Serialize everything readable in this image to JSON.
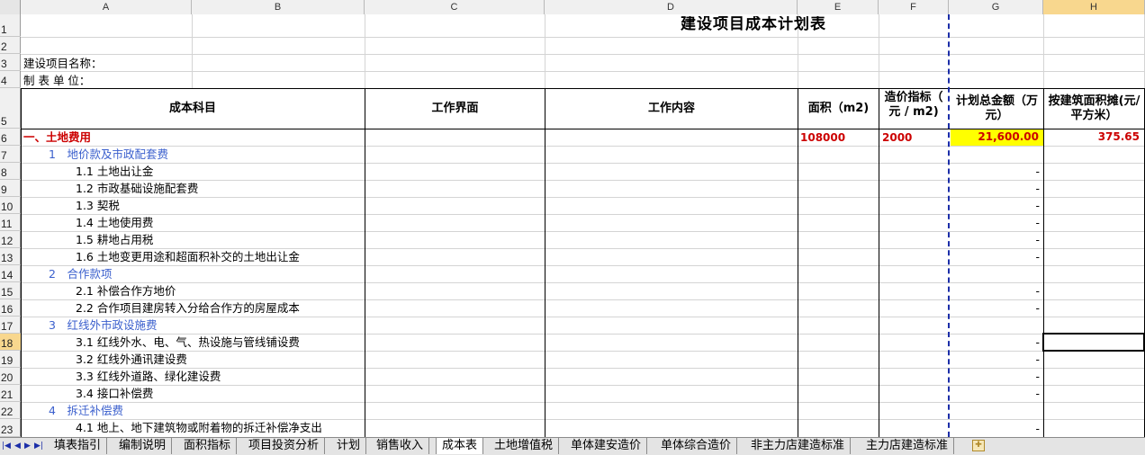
{
  "colors": {
    "header_bg": "#f0f0f0",
    "selected_header": "#f8d78e",
    "highlight_cell": "#ffff00",
    "section_red": "#cc0000",
    "subsection_blue": "#3a5fcd",
    "page_break": "#1c2ea8"
  },
  "columns": [
    "A",
    "B",
    "C",
    "D",
    "E",
    "F",
    "G",
    "H"
  ],
  "row_numbers": [
    "1",
    "2",
    "3",
    "4",
    "5",
    "6",
    "7",
    "8",
    "9",
    "10",
    "11",
    "12",
    "13",
    "14",
    "15",
    "16",
    "17",
    "18",
    "19",
    "20",
    "21",
    "22",
    "23"
  ],
  "sheet": {
    "title": "建设项目成本计划表",
    "project_name_label": "建设项目名称：",
    "unit_label": "制 表 单 位：",
    "headers": {
      "cost_item": "成本科目",
      "scope": "工作界面",
      "content": "工作内容",
      "area": "面积（m2)",
      "price_index": "造价指标（ 元 / m2)",
      "total": "计划总金额（万元）",
      "per_area": "按建筑面积摊(元/平方米）"
    },
    "rows": [
      {
        "label": "一、土地费用",
        "area": "108000",
        "price": "2000",
        "total": "21,600.00",
        "per_area": "375.65"
      },
      {
        "label": "1　地价款及市政配套费"
      },
      {
        "label": "1.1 土地出让金",
        "total": "-"
      },
      {
        "label": "1.2 市政基础设施配套费",
        "total": "-"
      },
      {
        "label": "1.3 契税",
        "total": "-"
      },
      {
        "label": "1.4 土地使用费",
        "total": "-"
      },
      {
        "label": "1.5 耕地占用税",
        "total": "-"
      },
      {
        "label": "1.6 土地变更用途和超面积补交的土地出让金",
        "total": "-"
      },
      {
        "label": "2　合作款项"
      },
      {
        "label": "2.1 补偿合作方地价",
        "total": "-"
      },
      {
        "label": "2.2 合作项目建房转入分给合作方的房屋成本",
        "total": "-"
      },
      {
        "label": "3　红线外市政设施费"
      },
      {
        "label": "3.1 红线外水、电、气、热设施与管线铺设费",
        "total": "-"
      },
      {
        "label": "3.2 红线外通讯建设费",
        "total": "-"
      },
      {
        "label": "3.3 红线外道路、绿化建设费",
        "total": "-"
      },
      {
        "label": "3.4 接口补偿费",
        "total": "-"
      },
      {
        "label": "4　拆迁补偿费"
      },
      {
        "label": "4.1 地上、地下建筑物或附着物的拆迁补偿净支出",
        "total": "-"
      }
    ]
  },
  "tabs": [
    "填表指引",
    "编制说明",
    "面积指标",
    "项目投资分析",
    "计划",
    "销售收入",
    "成本表",
    "土地增值税",
    "单体建安造价",
    "单体综合造价",
    "非主力店建造标准",
    "主力店建造标准"
  ],
  "active_tab": "成本表"
}
